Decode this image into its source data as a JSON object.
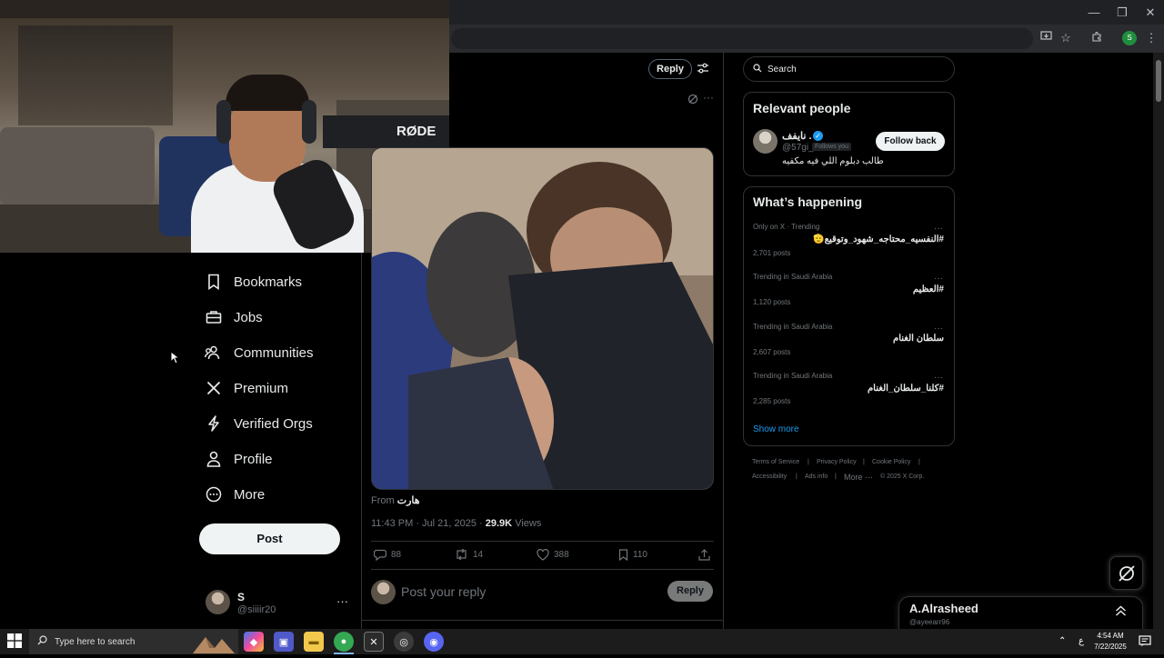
{
  "browser": {
    "window_controls": {
      "minimize": "—",
      "restore": "❐",
      "close": "✕"
    },
    "toolbar_icons": [
      "install-icon",
      "star-icon",
      "extensions-icon",
      "menu-icon"
    ],
    "profile_initial": "S"
  },
  "webcam": {
    "mic_brand": "RØDE"
  },
  "nav": {
    "items": [
      {
        "label": "Bookmarks",
        "icon": "bookmark-icon"
      },
      {
        "label": "Jobs",
        "icon": "briefcase-icon"
      },
      {
        "label": "Communities",
        "icon": "communities-icon"
      },
      {
        "label": "Premium",
        "icon": "x-logo-icon"
      },
      {
        "label": "Verified Orgs",
        "icon": "lightning-icon"
      },
      {
        "label": "Profile",
        "icon": "person-icon"
      },
      {
        "label": "More",
        "icon": "more-circle-icon"
      }
    ],
    "post_label": "Post",
    "account": {
      "name": "S",
      "handle": "@siiiir20",
      "more": "···"
    }
  },
  "tweet": {
    "reply_top_label": "Reply",
    "from_prefix": "From",
    "from_source": "هارت",
    "timestamp": "11:43 PM · Jul 21, 2025",
    "views_count": "29.9K",
    "views_label": "Views",
    "actions": {
      "replies": "88",
      "retweets": "14",
      "likes": "388",
      "bookmarks": "110"
    },
    "reply_placeholder": "Post your reply",
    "reply_button": "Reply"
  },
  "sidebar": {
    "search_placeholder": "Search",
    "relevant_people": {
      "title": "Relevant people",
      "person": {
        "name": "نايفف .",
        "handle": "@57gi_",
        "follows_you": "Follows you",
        "bio": "طالب دبلوم اللي فيه مكفيه",
        "follow_button": "Follow back"
      }
    },
    "whats_happening": {
      "title": "What’s happening",
      "trends": [
        {
          "context": "Only on X · Trending",
          "name": "#النفسيه_محتاجه_شهود_وتوقيع🫡",
          "posts": "2,701 posts"
        },
        {
          "context": "Trending in Saudi Arabia",
          "name": "#العظيم",
          "posts": "1,120 posts"
        },
        {
          "context": "Trending in Saudi Arabia",
          "name": "سلطان الغنام",
          "posts": "2,607 posts"
        },
        {
          "context": "Trending in Saudi Arabia",
          "name": "#كلنا_سلطان_الغنام",
          "posts": "2,285 posts"
        }
      ],
      "show_more": "Show more"
    },
    "footer": {
      "terms": "Terms of Service",
      "privacy": "Privacy Policy",
      "cookies": "Cookie Policy",
      "accessibility": "Accessibility",
      "ads": "Ads info",
      "more": "More ···",
      "copyright": "© 2025 X Corp."
    }
  },
  "messages": {
    "name": "A.Alrasheed",
    "handle": "@ayeearr96"
  },
  "taskbar": {
    "search_placeholder": "Type here to search",
    "time": "4:54 AM",
    "date": "7/22/2025",
    "lang": "ع"
  },
  "colors": {
    "accent": "#1d9bf0",
    "background": "#000000",
    "border": "#2f3336",
    "muted": "#71767b"
  }
}
